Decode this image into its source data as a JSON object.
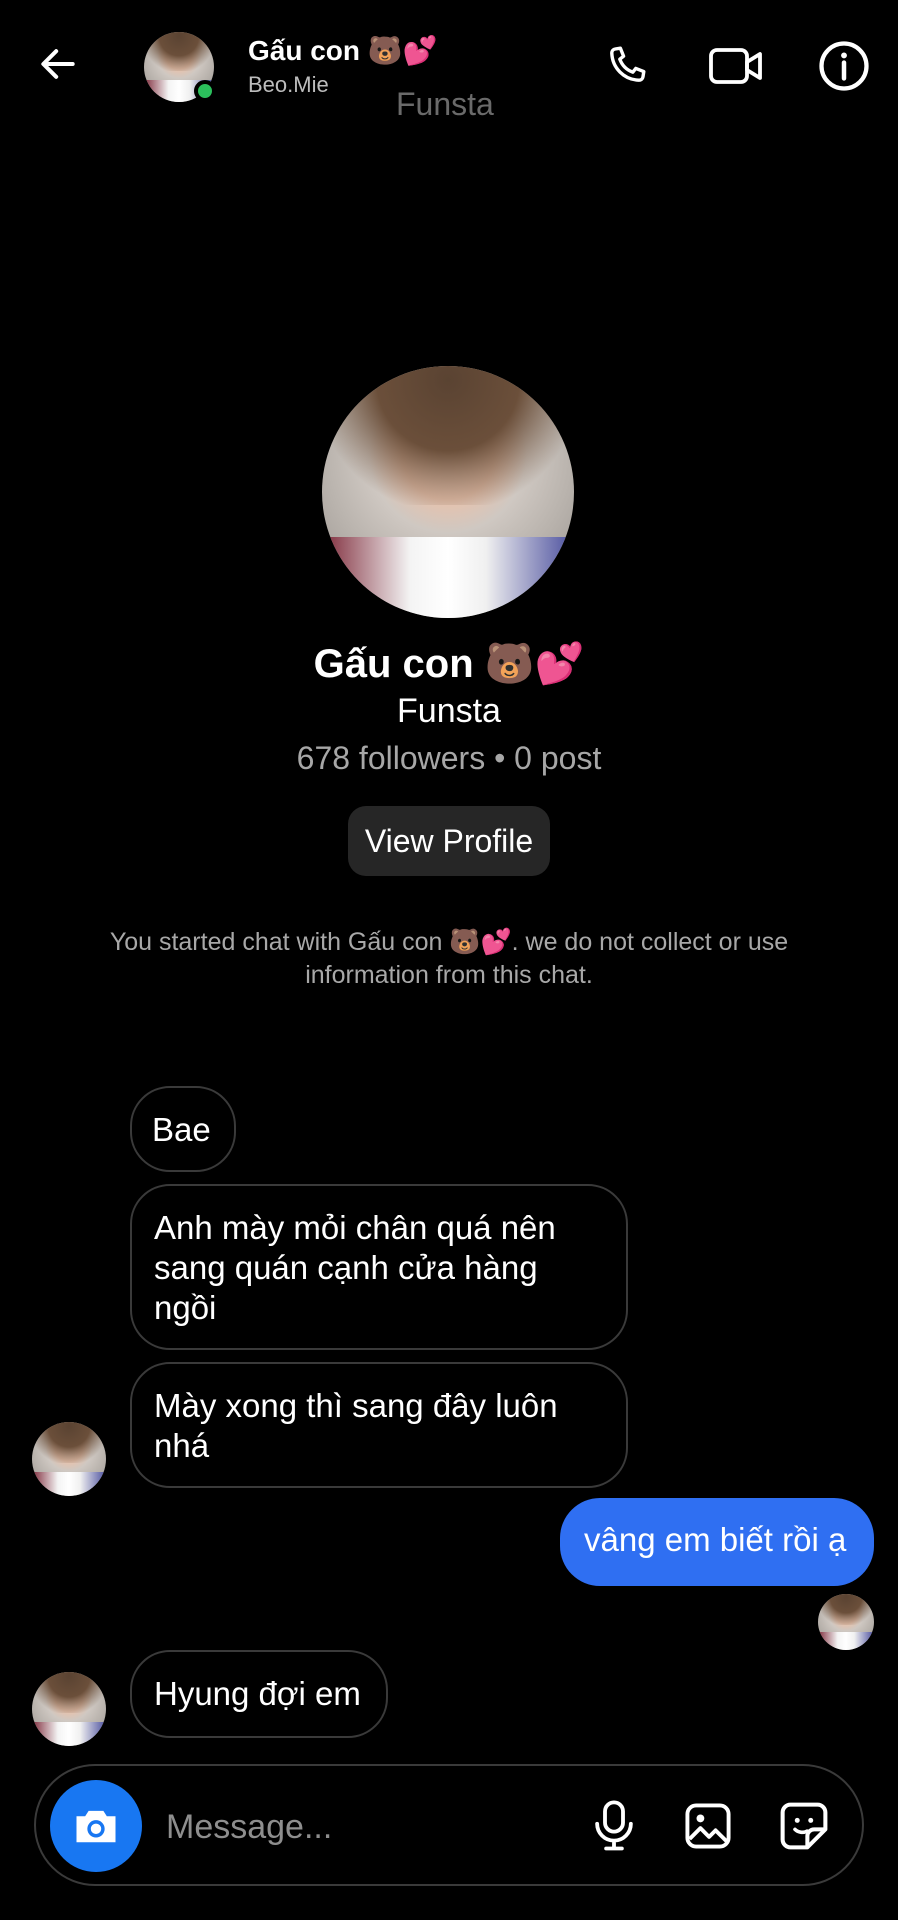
{
  "header": {
    "title": "Gấu con 🐻💕",
    "username": "Beo.Mie",
    "faint_label": "Funsta"
  },
  "profile": {
    "name": "Gấu con 🐻💕",
    "subtitle": "Funsta",
    "stats": "678 followers • 0 post",
    "view_button": "View Profile"
  },
  "notice": "You started chat with Gấu con 🐻💕. we do not collect or use information from this chat.",
  "messages": [
    {
      "from": "other",
      "text": "Bae"
    },
    {
      "from": "other",
      "text": "Anh mày mỏi chân quá nên sang quán cạnh cửa hàng ngồi"
    },
    {
      "from": "other",
      "text": "Mày xong thì sang đây luôn nhá"
    },
    {
      "from": "me",
      "text": "vâng em biết rồi ạ"
    },
    {
      "from": "other",
      "text": "Hyung đợi em"
    }
  ],
  "composer": {
    "placeholder": "Message..."
  },
  "icons": {
    "back": "back-arrow-icon",
    "call": "phone-icon",
    "video": "video-camera-icon",
    "info": "info-icon",
    "camera": "camera-icon",
    "mic": "microphone-icon",
    "gallery": "gallery-icon",
    "sticker": "sticker-icon"
  },
  "colors": {
    "background": "#000000",
    "sent_bubble": "#2f6ff2",
    "camera_button": "#1877f2",
    "online": "#2bbf5c"
  }
}
